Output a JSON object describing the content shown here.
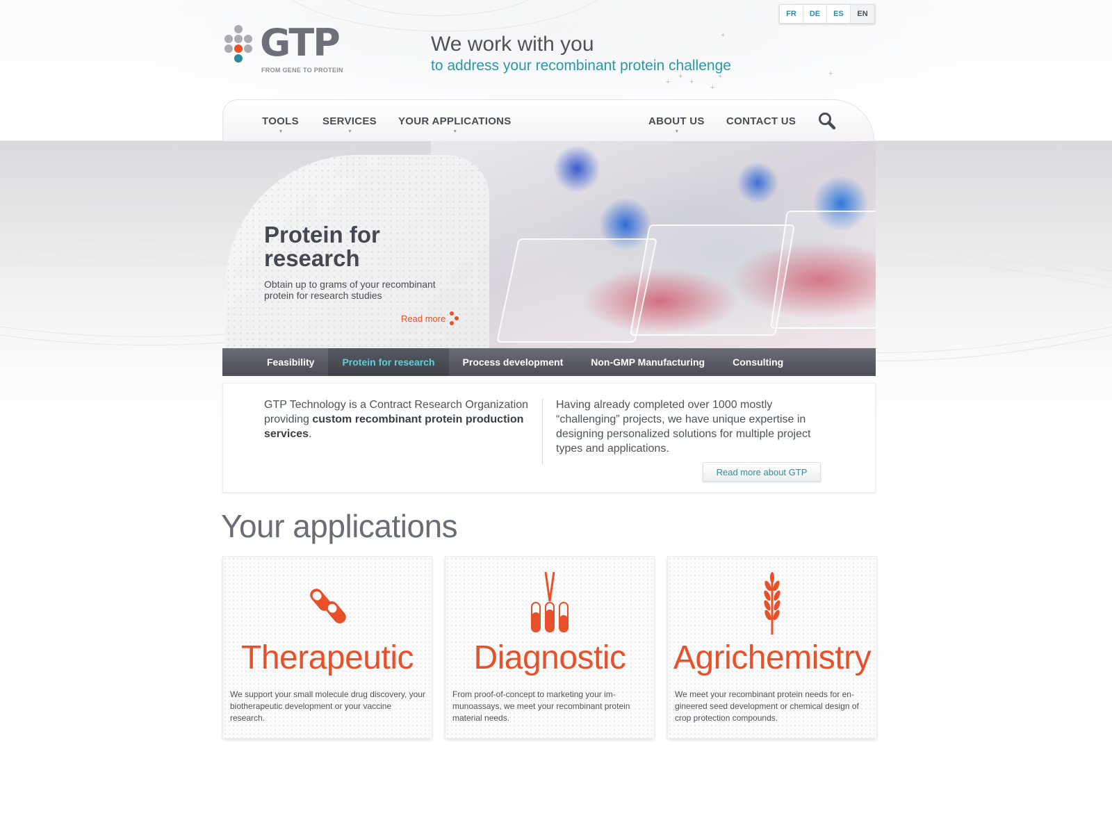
{
  "languages": [
    "FR",
    "DE",
    "ES",
    "EN"
  ],
  "logo": {
    "name": "GTP",
    "tagline": "FROM GENE TO PROTEIN"
  },
  "header": {
    "line1": "We work with you",
    "line2": "to address your recombinant protein challenge"
  },
  "nav": {
    "left": [
      "TOOLS",
      "SERVICES",
      "YOUR APPLICATIONS"
    ],
    "right": [
      "ABOUT US",
      "CONTACT US"
    ]
  },
  "hero": {
    "title": "Protein for research",
    "description": "Obtain up to grams of your recombinant protein for research studies",
    "read_more": "Read more"
  },
  "tabs": [
    {
      "label": "Feasibility",
      "active": false
    },
    {
      "label": "Protein for research",
      "active": true
    },
    {
      "label": "Process development",
      "active": false
    },
    {
      "label": "Non-GMP Manufacturing",
      "active": false
    },
    {
      "label": "Consulting",
      "active": false
    }
  ],
  "about": {
    "left_intro": "GTP Technology is a Contract Research Organization providing ",
    "left_bold": "custom recombinant protein production services",
    "left_end": ".",
    "right": "Having already completed over 1000 mostly “challenging” projects, we have unique expertise in designing personalized solutions for multiple project types and applications.",
    "button": "Read more about GTP"
  },
  "applications": {
    "heading": "Your applications",
    "items": [
      {
        "title": "Therapeutic",
        "icon": "pill-capsules-icon",
        "description": "We support your small molecule drug discovery, your biotherapeutic development or your vaccine research."
      },
      {
        "title": "Diagnostic",
        "icon": "test-tubes-icon",
        "description": "From proof-of-concept to marketing your im-munoassays, we meet your recombinant protein material needs."
      },
      {
        "title": "Agrichemistry",
        "icon": "wheat-icon",
        "description": "We meet your recombinant protein needs for en-gineered seed development or chemical design of crop protection compounds."
      }
    ]
  },
  "colors": {
    "accent_orange": "#e8502a",
    "accent_teal": "#2b97a8",
    "tab_active": "#5cd0dc",
    "text_dark": "#4a4d55"
  }
}
